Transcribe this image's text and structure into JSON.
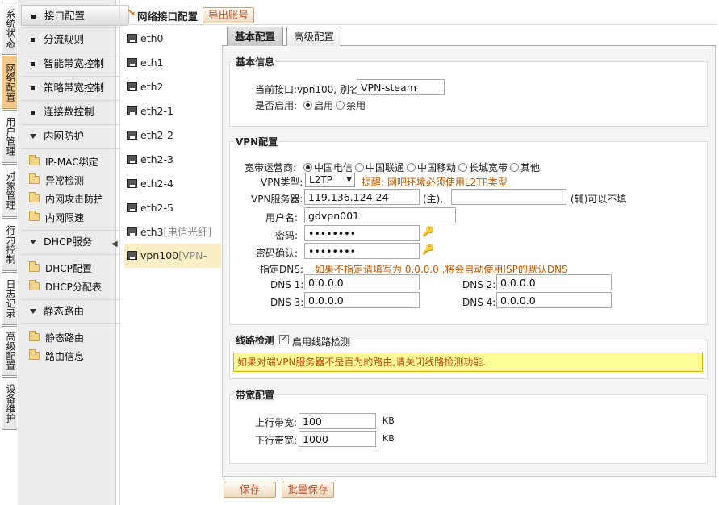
{
  "vtabs": [
    "系统状态",
    "网络配置",
    "用户管理",
    "对象管理",
    "行为控制",
    "日志记录",
    "高级配置",
    "设备维护"
  ],
  "menu": {
    "items": [
      "接口配置",
      "分流规则",
      "智能带宽控制",
      "策略带宽控制",
      "连接数控制"
    ],
    "groups": [
      {
        "title": "内网防护",
        "subs": [
          "IP-MAC绑定",
          "异常检测",
          "内网攻击防护",
          "内网限速"
        ]
      },
      {
        "title": "DHCP服务",
        "subs": [
          "DHCP配置",
          "DHCP分配表"
        ]
      },
      {
        "title": "静态路由",
        "subs": [
          "静态路由",
          "路由信息"
        ]
      }
    ]
  },
  "header": {
    "title": "网络接口配置",
    "export_label": "导出账号"
  },
  "interfaces": [
    "eth0",
    "eth1",
    "eth2",
    "eth2-1",
    "eth2-2",
    "eth2-3",
    "eth2-4",
    "eth2-5"
  ],
  "iface_eth3": {
    "name": "eth3",
    "note": "[电信光纤]"
  },
  "iface_vpn": {
    "name": "vpn100",
    "note": "[VPN-"
  },
  "tabs": {
    "basic": "基本配置",
    "advanced": "高级配置"
  },
  "basic": {
    "legend": "基本信息",
    "current_label": "当前接口:vpn100, 别名:",
    "alias": "VPN-steam",
    "enable_label": "是否启用:",
    "enable_on": "启用",
    "enable_off": "禁用"
  },
  "vpn": {
    "legend": "VPN配置",
    "isp_label": "宽带运营商:",
    "isp_options": [
      "中国电信",
      "中国联通",
      "中国移动",
      "长城宽带",
      "其他"
    ],
    "type_label": "VPN类型:",
    "type_value": "L2TP",
    "type_hint": "提醒: 网吧环境必须使用L2TP类型",
    "server_label": "VPN服务器:",
    "server_main": "119.136.124.24",
    "server_main_suffix": "(主),",
    "server_aux": "",
    "server_aux_suffix": "(辅)可以不填",
    "user_label": "用户名:",
    "user_value": "gdvpn001",
    "pwd_label": "密码:",
    "pwd_value": "••••••••",
    "pwd2_label": "密码确认:",
    "pwd2_value": "••••••••",
    "dns_label": "指定DNS:",
    "dns_hint": "如果不指定请填写为 0.0.0.0 ,将会自动使用ISP的默认DNS",
    "dns1_label": "DNS 1:",
    "dns1": "0.0.0.0",
    "dns2_label": "DNS 2:",
    "dns2": "0.0.0.0",
    "dns3_label": "DNS 3:",
    "dns3": "0.0.0.0",
    "dns4_label": "DNS 4:",
    "dns4": "0.0.0.0"
  },
  "line": {
    "legend": "线路检测",
    "check_label": "启用线路检测",
    "warning": "如果对端VPN服务器不是百为的路由,请关闭线路检测功能."
  },
  "bandwidth": {
    "legend": "带宽配置",
    "up_label": "上行带宽:",
    "up": "100",
    "up_unit": "KB",
    "down_label": "下行带宽:",
    "down": "1000",
    "down_unit": "KB"
  },
  "footer": {
    "save": "保存",
    "batch_save": "批量保存"
  },
  "colors": {
    "accent": "#c0502a",
    "selected_iface": "#fbeec4",
    "warning_bg": "#ffff99",
    "active_vtab": "#f3c88a"
  }
}
